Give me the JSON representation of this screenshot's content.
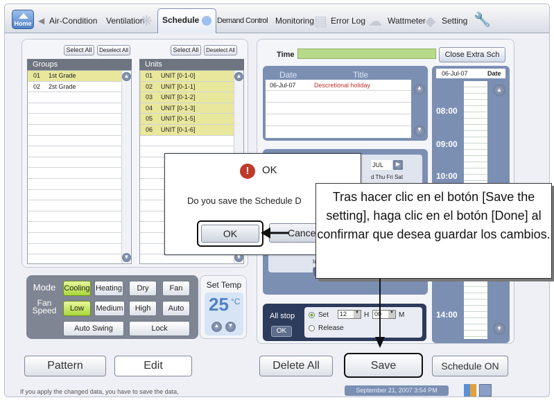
{
  "tabs": {
    "home": "Home",
    "items": [
      "Air-Condition",
      "Ventilation",
      "Schedule",
      "Demand Control",
      "Monitoring",
      "Error Log",
      "Wattmeter",
      "Setting"
    ],
    "active": "Schedule"
  },
  "groups": {
    "select_all": "Select All",
    "deselect_all": "Deselect All",
    "header": "Groups",
    "rows": [
      {
        "id": "01",
        "name": "1st Grade"
      },
      {
        "id": "02",
        "name": "2st Grade"
      }
    ]
  },
  "units": {
    "select_all": "Select All",
    "deselect_all": "Deselect All",
    "header": "Units",
    "rows": [
      {
        "id": "01",
        "name": "UNIT [0-1-0]"
      },
      {
        "id": "02",
        "name": "UNIT [0-1-1]"
      },
      {
        "id": "03",
        "name": "UNIT [0-1-2]"
      },
      {
        "id": "04",
        "name": "UNIT [0-1-3]"
      },
      {
        "id": "05",
        "name": "UNIT [0-1-5]"
      },
      {
        "id": "06",
        "name": "UNIT [0-1-6]"
      }
    ]
  },
  "controls": {
    "mode_label": "Mode",
    "modes": [
      "Cooling",
      "Heating",
      "Dry",
      "Fan"
    ],
    "fan_label_1": "Fan",
    "fan_label_2": "Speed",
    "fan_speeds": [
      "Low",
      "Medium",
      "High",
      "Auto"
    ],
    "auto_swing": "Auto Swing",
    "lock": "Lock",
    "set_temp_label": "Set Temp",
    "set_temp_value": "25",
    "set_temp_unit": "°C"
  },
  "schedule": {
    "time_label": "Time",
    "close_extra": "Close Extra Sch",
    "date_col": "Date",
    "title_col": "Title",
    "entries": [
      {
        "date": "06-Jul-07",
        "title": "Descretional holiday"
      }
    ],
    "month_partial": "JUL",
    "weekdays_partial": "d   Thu  Fri  Sat",
    "input_partial": "Inp",
    "a_partial": "A",
    "timeline_date": "06-Jul-07",
    "timeline_date_label": "Date",
    "times": [
      "08:00",
      "09:00",
      "10:00",
      "14:00"
    ]
  },
  "allstop": {
    "label": "All stop",
    "ok": "OK",
    "set": "Set",
    "hour": "12",
    "h": "H",
    "minute": "00",
    "m": "M",
    "release": "Release"
  },
  "buttons": {
    "pattern": "Pattern",
    "edit": "Edit",
    "delete_all": "Delete All",
    "save": "Save",
    "schedule_on": "Schedule ON"
  },
  "status": {
    "message": "If you apply the changed data,  you have to save the data,",
    "datetime": "September 21, 2007 3:54 PM"
  },
  "dialog": {
    "title": "OK",
    "message": "Do you save the Schedule D",
    "ok": "OK",
    "cancel": "Cance"
  },
  "callout": {
    "text": "Tras hacer clic en el botón [Save the setting], haga clic en el botón [Done] al confirmar que desea guardar los cambios."
  },
  "colors": {
    "accent": "#5f86c9",
    "selected_row": "#e9e79c",
    "active_button": "#a9d63a",
    "schedule_panel": "#7b8fb3",
    "holiday_text": "#c0302a"
  }
}
